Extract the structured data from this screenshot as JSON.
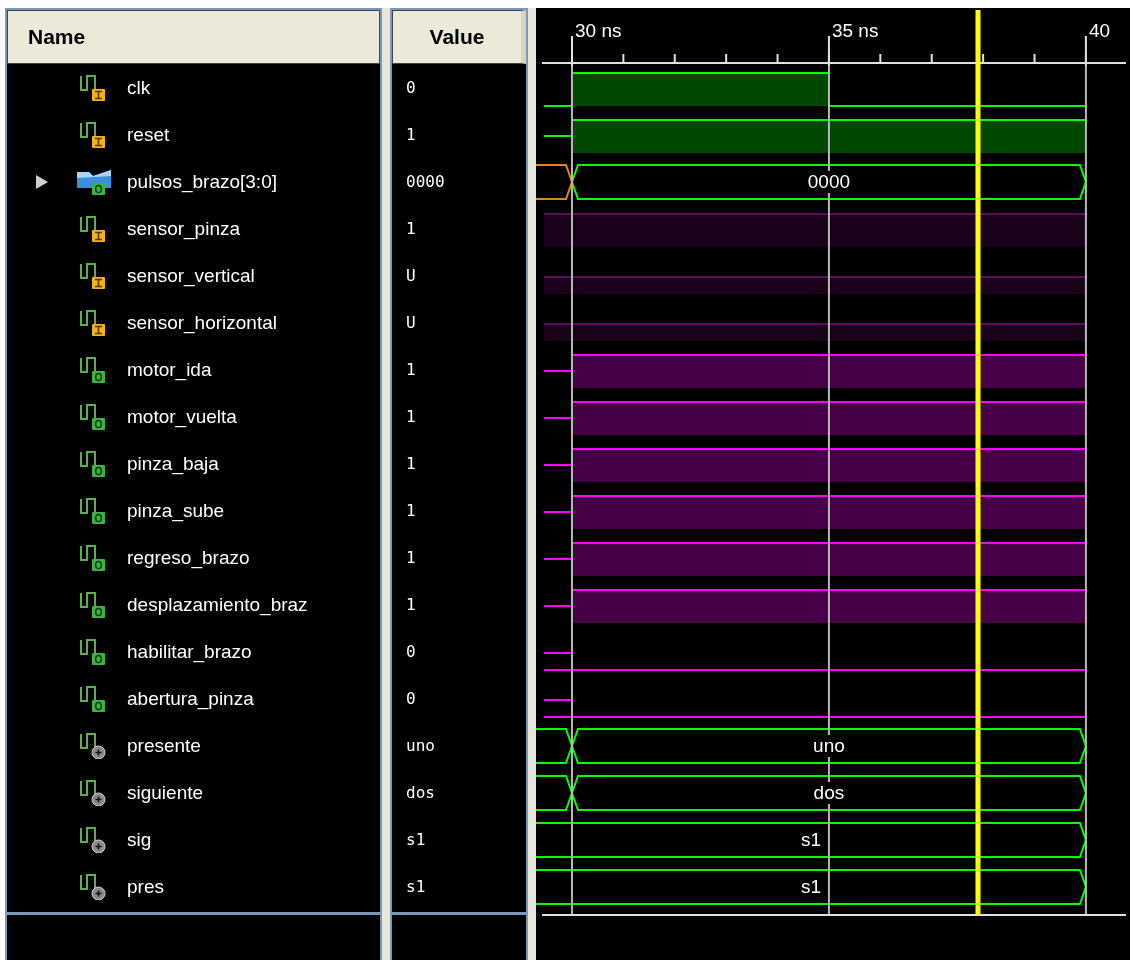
{
  "columns": {
    "name": "Name",
    "value": "Value"
  },
  "timeline": {
    "ticks": [
      "30 ns",
      "35 ns",
      "40"
    ]
  },
  "signals": [
    {
      "name": "clk",
      "value": "0",
      "kind": "input",
      "color": "#00ff00",
      "edge": true,
      "pulse": true
    },
    {
      "name": "reset",
      "value": "1",
      "kind": "input",
      "color": "#00ff00",
      "edge": true,
      "pulse": false
    },
    {
      "name": "pulsos_brazo[3:0]",
      "value": "0000",
      "kind": "bus",
      "expanded": false,
      "color": "#00ff00",
      "edge": true,
      "wave_label": "0000"
    },
    {
      "name": "sensor_pinza",
      "value": "1",
      "kind": "input",
      "color": "#5c0c5c",
      "edge": false,
      "pulse": false
    },
    {
      "name": "sensor_vertical",
      "value": "U",
      "kind": "input",
      "color": "#5c0c5c",
      "edge": false,
      "pulse": false
    },
    {
      "name": "sensor_horizontal",
      "value": "U",
      "kind": "input",
      "color": "#5c0c5c",
      "edge": false,
      "pulse": false
    },
    {
      "name": "motor_ida",
      "value": "1",
      "kind": "output",
      "color": "#ff00ff",
      "edge": true,
      "pulse": false
    },
    {
      "name": "motor_vuelta",
      "value": "1",
      "kind": "output",
      "color": "#ff00ff",
      "edge": true,
      "pulse": false
    },
    {
      "name": "pinza_baja",
      "value": "1",
      "kind": "output",
      "color": "#ff00ff",
      "edge": true,
      "pulse": false
    },
    {
      "name": "pinza_sube",
      "value": "1",
      "kind": "output",
      "color": "#ff00ff",
      "edge": true,
      "pulse": false
    },
    {
      "name": "regreso_brazo",
      "value": "1",
      "kind": "output",
      "color": "#ff00ff",
      "edge": true,
      "pulse": false
    },
    {
      "name": "desplazamiento_braz",
      "value": "1",
      "kind": "output",
      "color": "#ff00ff",
      "edge": true,
      "pulse": false
    },
    {
      "name": "habilitar_brazo",
      "value": "0",
      "kind": "output",
      "color": "#ff00ff",
      "edge": true,
      "pulse": false
    },
    {
      "name": "abertura_pinza",
      "value": "0",
      "kind": "output",
      "color": "#ff00ff",
      "edge": true,
      "pulse": false
    },
    {
      "name": "presente",
      "value": "uno",
      "kind": "internal",
      "color": "#00ff00",
      "edge": true,
      "wave_label": "uno"
    },
    {
      "name": "siguiente",
      "value": "dos",
      "kind": "internal",
      "color": "#00ff00",
      "edge": true,
      "wave_label": "dos"
    },
    {
      "name": "sig",
      "value": "s1",
      "kind": "internal",
      "color": "#00ff00",
      "edge": false,
      "wave_label": "s1"
    },
    {
      "name": "pres",
      "value": "s1",
      "kind": "internal",
      "color": "#00ff00",
      "edge": false,
      "wave_label": "s1"
    }
  ]
}
